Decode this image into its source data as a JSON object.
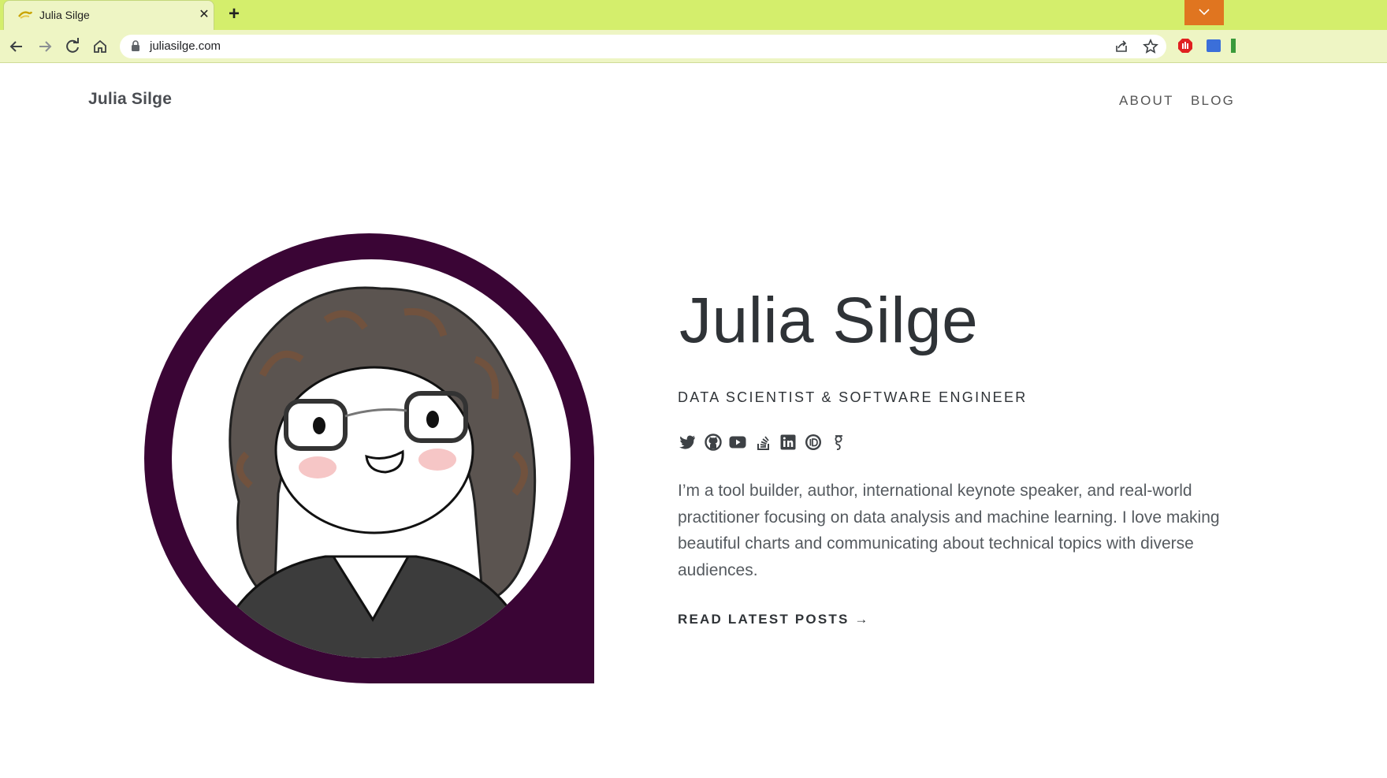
{
  "browser": {
    "tab_title": "Julia Silge",
    "tab_close": "✕",
    "new_tab": "+",
    "url": "juliasilge.com",
    "theme_color": "#d4ee6c",
    "toolbar_color": "#eef5c4",
    "icons": [
      "back-icon",
      "forward-icon",
      "reload-icon",
      "home-icon",
      "lock-icon",
      "share-icon",
      "star-icon"
    ]
  },
  "site": {
    "title": "Julia Silge",
    "nav": {
      "about": "ABOUT",
      "blog": "BLOG"
    }
  },
  "hero": {
    "name": "Julia Silge",
    "role": "DATA SCIENTIST & SOFTWARE ENGINEER",
    "bio": "I’m a tool builder, author, international keynote speaker, and real-world practitioner focusing on data analysis and machine learning. I love making beautiful charts and communicating about technical topics with diverse audiences.",
    "cta": "READ LATEST POSTS →",
    "accent_color": "#3a0535",
    "social_icons": [
      "twitter-icon",
      "github-icon",
      "youtube-icon",
      "stackoverflow-icon",
      "linkedin-icon",
      "orcid-icon",
      "google-scholar-icon"
    ]
  }
}
